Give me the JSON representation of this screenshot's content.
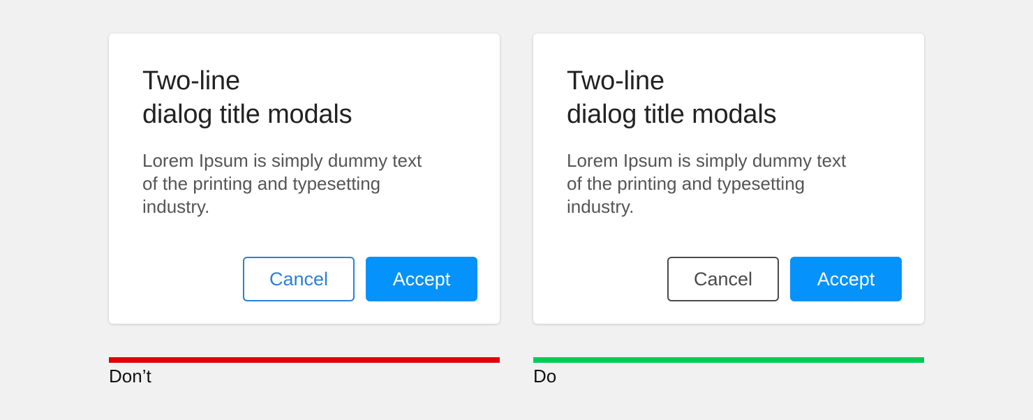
{
  "colors": {
    "background": "#f1f1f1",
    "primary_button": "#0592fa",
    "dont_secondary": "#2a7fe0",
    "do_secondary": "#4a4a4a",
    "dont_indicator": "#e0000b",
    "do_indicator": "#00cc55"
  },
  "examples": [
    {
      "kind": "dont",
      "dialog": {
        "title_line1": "Two-line",
        "title_line2": "dialog title modals",
        "body_line1": "Lorem Ipsum is simply dummy text",
        "body_line2": "of the printing and typesetting",
        "body_line3": "industry.",
        "cancel_label": "Cancel",
        "accept_label": "Accept"
      },
      "verdict_label": "Don’t"
    },
    {
      "kind": "do",
      "dialog": {
        "title_line1": "Two-line",
        "title_line2": "dialog title modals",
        "body_line1": "Lorem Ipsum is simply dummy text",
        "body_line2": "of the printing and typesetting",
        "body_line3": "industry.",
        "cancel_label": "Cancel",
        "accept_label": "Accept"
      },
      "verdict_label": "Do"
    }
  ]
}
